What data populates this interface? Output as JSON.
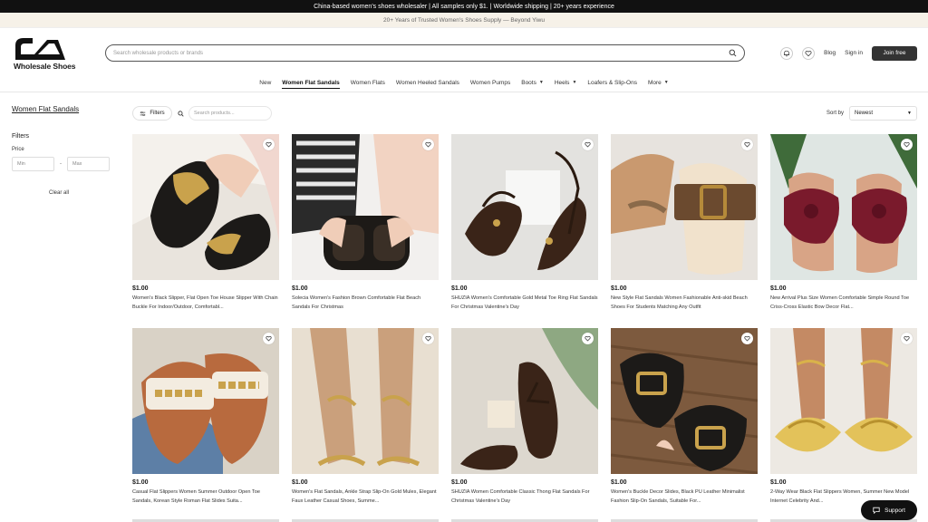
{
  "topbar": {
    "text": "China-based women's shoes wholesaler | All samples only $1. | Worldwide shipping | 20+ years experience"
  },
  "subbar": {
    "text": "20+ Years of Trusted Women's Shoes Supply — Beyond Yiwu"
  },
  "header": {
    "logo_text": "Wholesale Shoes",
    "search_placeholder": "Search wholesale products or brands",
    "blog": "Blog",
    "sign_in": "Sign in",
    "join": "Join free"
  },
  "nav": {
    "items": [
      {
        "label": "New"
      },
      {
        "label": "Women Flat Sandals"
      },
      {
        "label": "Women Flats"
      },
      {
        "label": "Women Heeled Sandals"
      },
      {
        "label": "Women Pumps"
      },
      {
        "label": "Boots"
      },
      {
        "label": "Heels"
      },
      {
        "label": "Loafers & Slip-Ons"
      },
      {
        "label": "More"
      }
    ]
  },
  "sidebar": {
    "category": "Women Flat Sandals",
    "filters": "Filters",
    "price_label": "Price",
    "min_placeholder": "Min",
    "max_placeholder": "Max",
    "clear_all": "Clear all"
  },
  "toolbar": {
    "filters_label": "Filters",
    "search_placeholder": "Search products...",
    "sort_label": "Sort by",
    "sort_value": "Newest"
  },
  "products": [
    {
      "price": "$1.00",
      "name": "Women's Black Slipper, Flat Open Toe House Slipper With Chain Buckle For Indoor/Outdoor, Comfortabl..."
    },
    {
      "price": "$1.00",
      "name": "Solecia Women's Fashion Brown Comfortable Flat Beach Sandals For Christmas"
    },
    {
      "price": "$1.00",
      "name": "SHUZIA Women's Comfortable Gold Metal Toe Ring Flat Sandals For Christmas Valentine's Day"
    },
    {
      "price": "$1.00",
      "name": "New Style Flat Sandals Women Fashionable Anti-skid Beach Shoes For Students Matching Any Outfit"
    },
    {
      "price": "$1.00",
      "name": "New Arrival Plus Size Women Comfortable Simple Round Toe Criss-Cross Elastic Bow Decor Flat..."
    },
    {
      "price": "$1.00",
      "name": "Casual Flat Slippers Women Summer Outdoor Open Toe Sandals, Korean Style Roman Flat Slides Suita..."
    },
    {
      "price": "$1.00",
      "name": "Women's Flat Sandals, Ankle Strap Slip-On Gold Mules, Elegant Faux Leather Casual Shoes, Summe..."
    },
    {
      "price": "$1.00",
      "name": "SHUZIA Women Comfortable Classic Thong Flat Sandals For Christmas Valentine's Day"
    },
    {
      "price": "$1.00",
      "name": "Women's Buckle Decor Slides, Black PU Leather Minimalist Fashion Slip-On Sandals, Suitable For..."
    },
    {
      "price": "$1.00",
      "name": "2-Way Wear Black Flat Slippers Women, Summer New Model Internet Celebrity And..."
    }
  ],
  "support": "Support"
}
